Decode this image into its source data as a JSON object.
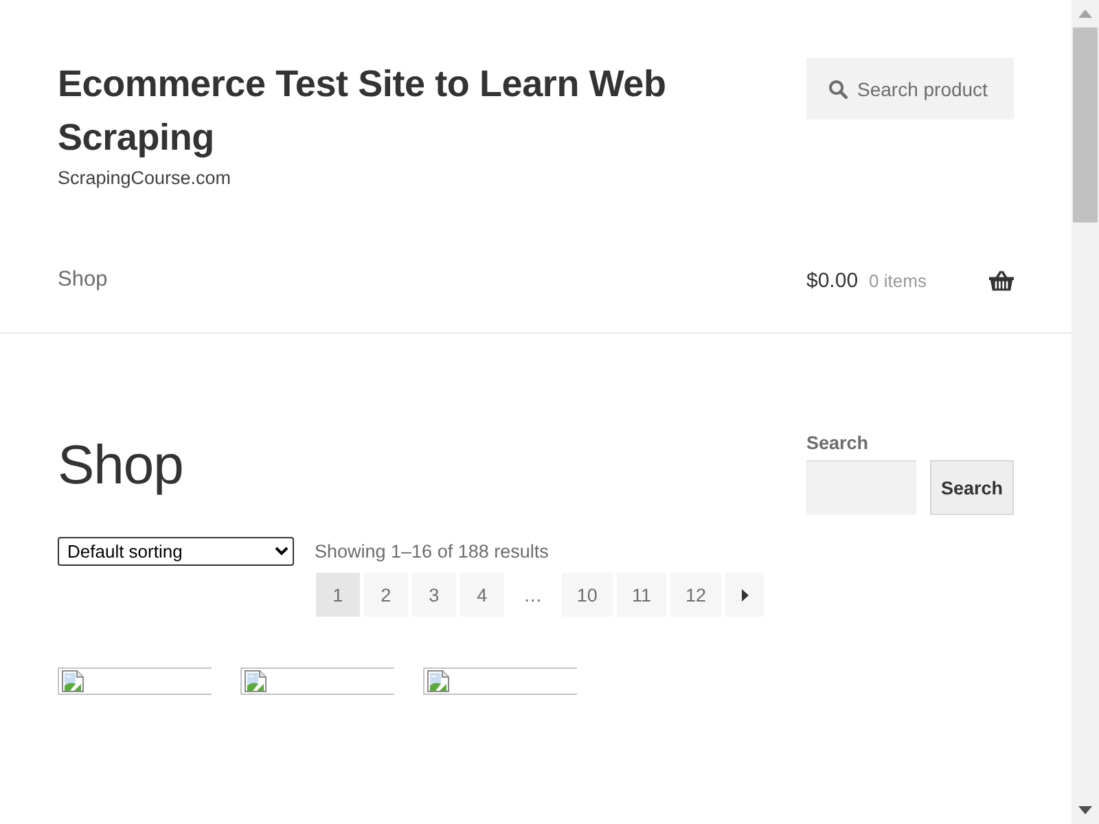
{
  "header": {
    "title": "Ecommerce Test Site to Learn Web Scraping",
    "tagline": "ScrapingCourse.com",
    "product_search": {
      "placeholder": "Search product"
    }
  },
  "nav": {
    "items": [
      {
        "label": "Shop"
      }
    ],
    "cart": {
      "total": "$0.00",
      "count": "0 items"
    }
  },
  "main": {
    "title": "Shop",
    "sorting": {
      "value": "Default sorting"
    },
    "result_count": "Showing 1–16 of 188 results",
    "pagination": [
      {
        "kind": "page",
        "label": "1",
        "selected": true
      },
      {
        "kind": "page",
        "label": "2",
        "selected": false
      },
      {
        "kind": "page",
        "label": "3",
        "selected": false
      },
      {
        "kind": "page",
        "label": "4",
        "selected": false
      },
      {
        "kind": "dots",
        "label": "…"
      },
      {
        "kind": "page",
        "label": "10",
        "selected": false
      },
      {
        "kind": "page",
        "label": "11",
        "selected": false
      },
      {
        "kind": "page",
        "label": "12",
        "selected": false
      },
      {
        "kind": "next",
        "selected": false
      }
    ],
    "products": [
      {
        "kind": "broken-image"
      },
      {
        "kind": "broken-image"
      },
      {
        "kind": "broken-image"
      }
    ]
  },
  "sidebar": {
    "widget_title": "Search",
    "search_button": "Search"
  }
}
